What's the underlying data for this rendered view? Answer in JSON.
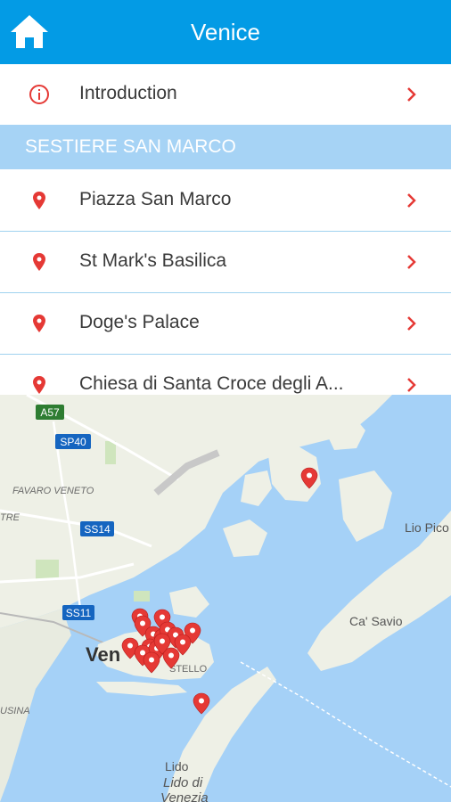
{
  "header": {
    "title": "Venice",
    "home_icon": "home-icon"
  },
  "intro": {
    "label": "Introduction",
    "icon": "info-icon"
  },
  "section": {
    "title": "SESTIERE SAN MARCO"
  },
  "items": [
    {
      "label": "Piazza San Marco",
      "icon": "map-pin-icon"
    },
    {
      "label": "St Mark's Basilica",
      "icon": "map-pin-icon"
    },
    {
      "label": "Doge's Palace",
      "icon": "map-pin-icon"
    },
    {
      "label": "Chiesa di Santa Croce degli A...",
      "icon": "map-pin-icon"
    }
  ],
  "map": {
    "labels": {
      "a57": "A57",
      "sp40": "SP40",
      "ss14": "SS14",
      "ss11": "SS11",
      "favaro": "FAVARO VENETO",
      "tre": "TRE",
      "lio_pico": "Lio Pico",
      "ca_savio": "Ca' Savio",
      "venice": "Ven",
      "castello": "STELLO",
      "usina": "USINA",
      "lido": "Lido",
      "lido_di": "Lido di",
      "venezia": "Venezia"
    }
  },
  "colors": {
    "header": "#039be5",
    "section": "#a6d3f5",
    "accent_red": "#e53935",
    "divider": "#9fd2ef",
    "water": "#a5d1f7",
    "land": "#eef0e6"
  }
}
